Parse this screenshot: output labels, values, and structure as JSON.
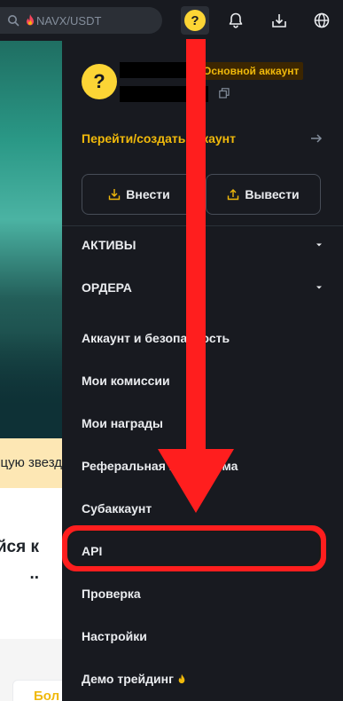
{
  "search": {
    "query": "NAVX/USDT",
    "icon": "search-icon"
  },
  "header": {
    "avatar_glyph": "?",
    "icons": [
      "avatar-icon",
      "bell-icon",
      "download-icon",
      "globe-icon"
    ]
  },
  "background_page": {
    "banner_text": "цую звезд",
    "heading_line1": "йся к",
    "heading_line2": "..",
    "card_text": "Бол"
  },
  "account": {
    "avatar_glyph": "?",
    "badge": "Основной аккаунт",
    "goto_label": "Перейти/создать аккаунт"
  },
  "actions": {
    "deposit_label": "Внести",
    "withdraw_label": "Вывести"
  },
  "menu": {
    "assets": "АКТИВЫ",
    "orders": "ОРДЕРА",
    "security": "Аккаунт и безопасность",
    "fees": "Мои комиссии",
    "rewards": "Мои награды",
    "referral": "Реферальная Программа",
    "subaccount": "Субаккаунт",
    "api": "API",
    "verification": "Проверка",
    "settings": "Настройки",
    "demo": "Демо трейдинг"
  },
  "colors": {
    "accent": "#f0b90b",
    "annotation_red": "#ff1e1e",
    "drawer_bg": "#181a20"
  }
}
